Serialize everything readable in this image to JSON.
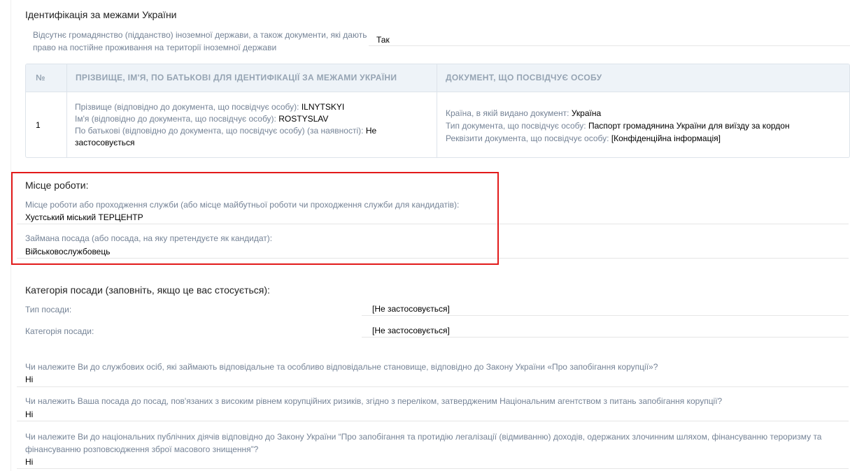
{
  "identification": {
    "heading": "Ідентифікація за межами України",
    "absence_label_line1": "Відсутнє громадянство (підданство) іноземної держави, а також документи, які дають",
    "absence_label_line2": "право на постійне проживання на території іноземної держави",
    "absence_value": "Так",
    "table": {
      "headers": [
        "№",
        "ПРІЗВИЩЕ, ІМ'Я, ПО БАТЬКОВІ ДЛЯ ІДЕНТИФІКАЦІЇ ЗА МЕЖАМИ УКРАЇНИ",
        "ДОКУМЕНТ, ЩО ПОСВІДЧУЄ ОСОБУ"
      ],
      "row": {
        "num": "1",
        "surname_label": "Прізвище (відповідно до документа, що посвідчує особу):",
        "surname_value": "ILNYTSKYI",
        "name_label": "Ім'я (відповідно до документа, що посвідчує особу):",
        "name_value": "ROSTYSLAV",
        "patronymic_label": "По батькові (відповідно до документа, що посвідчує особу) (за наявності):",
        "patronymic_value_part1": "Не",
        "patronymic_value_part2": "застосовується",
        "country_label": "Країна, в якій видано документ:",
        "country_value": "Україна",
        "doctype_label": "Тип документа, що посвідчує особу:",
        "doctype_value": "Паспорт громадянина України для виїзду за кордон",
        "docreq_label": "Реквізити документа, що посвідчує особу:",
        "docreq_value": "[Конфіденційна інформація]"
      }
    }
  },
  "work": {
    "heading": "Місце роботи:",
    "place_label": "Місце роботи або проходження служби (або місце майбутньої роботи чи проходження служби для кандидатів):",
    "place_value": "Хустський міський ТЕРЦЕНТР",
    "position_label": "Займана посада (або посада, на яку претендуєте як кандидат):",
    "position_value": "Військовослужбовець"
  },
  "category": {
    "heading": "Категорія посади (заповніть, якщо це вас стосується):",
    "type_label": "Тип посади:",
    "type_value": "[Не застосовується]",
    "category_label": "Категорія посади:",
    "category_value": "[Не застосовується]"
  },
  "questions": [
    {
      "q1": "Чи належите Ви до службових осіб, які займають відповідальне та особливо відповідальне становище, відповідно до Закону України «Про запобігання корупції»?",
      "q2": "",
      "a": "Ні"
    },
    {
      "q1": "Чи належить Ваша посада до посад, пов'язаних з високим рівнем корупційних ризиків, згідно з переліком, затвердженим Національним агентством з питань запобігання корупції?",
      "q2": "",
      "a": "Ні"
    },
    {
      "q1": "Чи належите Ви до національних публічних діячів відповідно до Закону України “Про запобігання та протидію легалізації (відмиванню) доходів, одержаних злочинним шляхом, фінансуванню тероризму та",
      "q2": "фінансуванню розповсюдження зброї масового знищення”?",
      "a": "Ні"
    }
  ]
}
